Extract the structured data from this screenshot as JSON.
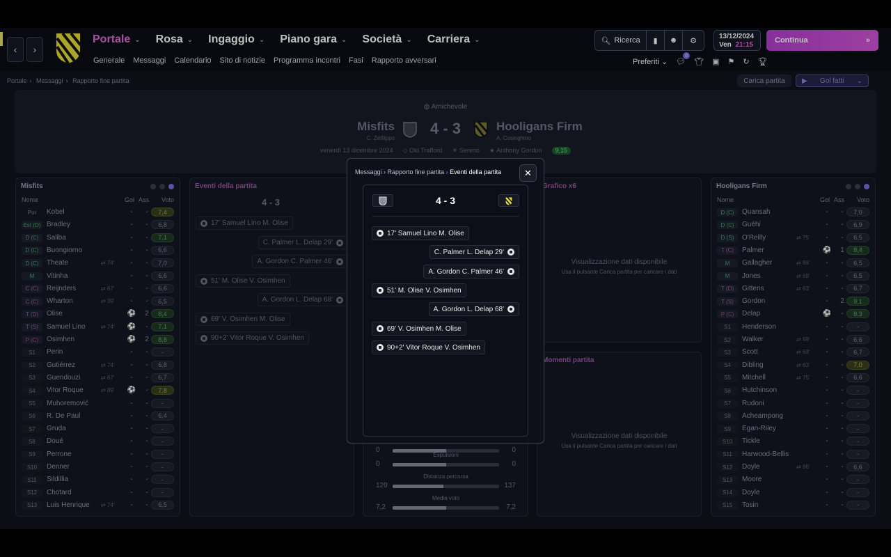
{
  "nav": {
    "items": [
      {
        "label": "Portale",
        "active": true
      },
      {
        "label": "Rosa"
      },
      {
        "label": "Ingaggio"
      },
      {
        "label": "Piano gara"
      },
      {
        "label": "Società"
      },
      {
        "label": "Carriera"
      }
    ],
    "sub": [
      "Generale",
      "Messaggi",
      "Calendario",
      "Sito di notizie",
      "Programma incontri",
      "Fasi",
      "Rapporto avversari"
    ],
    "search_label": "Ricerca",
    "date": "13/12/2024",
    "day": "Ven",
    "time": "21:15",
    "continue_label": "Continua",
    "favorites_label": "Preferiti",
    "notif_count": "0"
  },
  "breadcrumb": [
    "Portale",
    "Messaggi",
    "Rapporto fine partita"
  ],
  "actions": {
    "load_label": "Carica partita",
    "goals_label": "Gol fatti"
  },
  "match": {
    "competition": "Amichevole",
    "home": "Misfits",
    "home_coach": "C. Zefilippo",
    "away": "Hooligans Firm",
    "away_coach": "A. Cosinghino",
    "score": "4 - 3",
    "date": "venerdì 13 dicembre 2024",
    "stadium": "Old Trafford",
    "weather": "Sereno",
    "potm": "Anthony Gordon",
    "potm_rating": "9,15"
  },
  "columns": {
    "name": "Nome",
    "goals": "Gol",
    "assists": "Ass",
    "rating": "Voto"
  },
  "home_players": [
    {
      "pos": "Por",
      "cls": "por",
      "name": "Kobel",
      "ev": "",
      "g": "-",
      "a": "-",
      "v": "7,4",
      "vc": "yellow"
    },
    {
      "pos": "Est (D)",
      "cls": "dc",
      "name": "Bradley",
      "ev": "",
      "g": "-",
      "a": "-",
      "v": "6,8",
      "vc": ""
    },
    {
      "pos": "D (C)",
      "cls": "dc",
      "name": "Saliba",
      "ev": "",
      "g": "-",
      "a": "-",
      "v": "7,1",
      "vc": "green"
    },
    {
      "pos": "D (C)",
      "cls": "dc",
      "name": "Buongiorno",
      "ev": "",
      "g": "-",
      "a": "-",
      "v": "6,6",
      "vc": ""
    },
    {
      "pos": "D (C)",
      "cls": "dc",
      "name": "Theate",
      "ev": "74'",
      "g": "-",
      "a": "-",
      "v": "7,0",
      "vc": ""
    },
    {
      "pos": "M",
      "cls": "mc",
      "name": "Vitinha",
      "ev": "",
      "g": "-",
      "a": "-",
      "v": "6,6",
      "vc": ""
    },
    {
      "pos": "C (C)",
      "cls": "tc",
      "name": "Reijnders",
      "ev": "67'",
      "g": "-",
      "a": "-",
      "v": "6,6",
      "vc": ""
    },
    {
      "pos": "C (C)",
      "cls": "tc",
      "name": "Wharton",
      "ev": "39'",
      "g": "-",
      "a": "-",
      "v": "6,5",
      "vc": ""
    },
    {
      "pos": "T (D)",
      "cls": "tc",
      "name": "Olise",
      "ev": "",
      "g": "⚽",
      "a": "2",
      "v": "8,4",
      "vc": "green"
    },
    {
      "pos": "T (S)",
      "cls": "tc",
      "name": "Samuel Lino",
      "ev": "74'",
      "g": "⚽",
      "a": "-",
      "v": "7,1",
      "vc": "green"
    },
    {
      "pos": "P (C)",
      "cls": "pc",
      "name": "Osimhen",
      "ev": "",
      "g": "⚽",
      "a": "2",
      "v": "8,8",
      "vc": "green"
    },
    {
      "pos": "S1",
      "cls": "sub",
      "name": "Perin",
      "ev": "",
      "g": "-",
      "a": "-",
      "v": "-",
      "vc": ""
    },
    {
      "pos": "S2",
      "cls": "sub",
      "name": "Gutiérrez",
      "ev": "74'",
      "g": "-",
      "a": "-",
      "v": "6,8",
      "vc": ""
    },
    {
      "pos": "S3",
      "cls": "sub",
      "name": "Guendouzi",
      "ev": "67'",
      "g": "-",
      "a": "-",
      "v": "6,7",
      "vc": ""
    },
    {
      "pos": "S4",
      "cls": "sub",
      "name": "Vitor Roque",
      "ev": "89'",
      "g": "⚽",
      "a": "-",
      "v": "7,8",
      "vc": "yellow"
    },
    {
      "pos": "S5",
      "cls": "sub",
      "name": "Muhoremović",
      "ev": "",
      "g": "-",
      "a": "-",
      "v": "-",
      "vc": ""
    },
    {
      "pos": "S6",
      "cls": "sub",
      "name": "R. De Paul",
      "ev": "",
      "g": "-",
      "a": "-",
      "v": "6,4",
      "vc": ""
    },
    {
      "pos": "S7",
      "cls": "sub",
      "name": "Gruda",
      "ev": "",
      "g": "-",
      "a": "-",
      "v": "-",
      "vc": ""
    },
    {
      "pos": "S8",
      "cls": "sub",
      "name": "Doué",
      "ev": "",
      "g": "-",
      "a": "-",
      "v": "-",
      "vc": ""
    },
    {
      "pos": "S9",
      "cls": "sub",
      "name": "Perrone",
      "ev": "",
      "g": "-",
      "a": "-",
      "v": "-",
      "vc": ""
    },
    {
      "pos": "S10",
      "cls": "sub",
      "name": "Denner",
      "ev": "",
      "g": "-",
      "a": "-",
      "v": "-",
      "vc": ""
    },
    {
      "pos": "S11",
      "cls": "sub",
      "name": "Sildillia",
      "ev": "",
      "g": "-",
      "a": "-",
      "v": "-",
      "vc": ""
    },
    {
      "pos": "S12",
      "cls": "sub",
      "name": "Chotard",
      "ev": "",
      "g": "-",
      "a": "-",
      "v": "-",
      "vc": ""
    },
    {
      "pos": "S13",
      "cls": "sub",
      "name": "Luis Henrique",
      "ev": "74'",
      "g": "-",
      "a": "-",
      "v": "6,5",
      "vc": ""
    }
  ],
  "away_players": [
    {
      "pos": "D (C)",
      "cls": "dc",
      "name": "Quansah",
      "ev": "",
      "g": "-",
      "a": "-",
      "v": "7,0",
      "vc": ""
    },
    {
      "pos": "D (C)",
      "cls": "dc",
      "name": "Guéhi",
      "ev": "",
      "g": "-",
      "a": "-",
      "v": "6,9",
      "vc": ""
    },
    {
      "pos": "D (S)",
      "cls": "dc",
      "name": "O'Reilly",
      "ev": "75'",
      "g": "-",
      "a": "-",
      "v": "6,5",
      "vc": ""
    },
    {
      "pos": "T (C)",
      "cls": "tc",
      "name": "Palmer",
      "ev": "",
      "g": "⚽",
      "a": "1",
      "v": "8,4",
      "vc": "green"
    },
    {
      "pos": "M",
      "cls": "mc",
      "name": "Gallagher",
      "ev": "86'",
      "g": "-",
      "a": "-",
      "v": "6,5",
      "vc": ""
    },
    {
      "pos": "M",
      "cls": "mc",
      "name": "Jones",
      "ev": "69'",
      "g": "-",
      "a": "-",
      "v": "6,5",
      "vc": ""
    },
    {
      "pos": "T (D)",
      "cls": "tc",
      "name": "Gittens",
      "ev": "63'",
      "g": "-",
      "a": "-",
      "v": "6,7",
      "vc": ""
    },
    {
      "pos": "T (S)",
      "cls": "tc",
      "name": "Gordon",
      "ev": "",
      "g": "-",
      "a": "2",
      "v": "9,1",
      "vc": "green"
    },
    {
      "pos": "P (C)",
      "cls": "pc",
      "name": "Delap",
      "ev": "",
      "g": "⚽",
      "a": "-",
      "v": "8,3",
      "vc": "green"
    },
    {
      "pos": "S1",
      "cls": "sub",
      "name": "Henderson",
      "ev": "",
      "g": "-",
      "a": "-",
      "v": "-",
      "vc": ""
    },
    {
      "pos": "S2",
      "cls": "sub",
      "name": "Walker",
      "ev": "59'",
      "g": "-",
      "a": "-",
      "v": "6,6",
      "vc": ""
    },
    {
      "pos": "S3",
      "cls": "sub",
      "name": "Scott",
      "ev": "69'",
      "g": "-",
      "a": "-",
      "v": "6,7",
      "vc": ""
    },
    {
      "pos": "S4",
      "cls": "sub",
      "name": "Dibling",
      "ev": "63'",
      "g": "-",
      "a": "-",
      "v": "7,0",
      "vc": "yellow"
    },
    {
      "pos": "S5",
      "cls": "sub",
      "name": "Mitchell",
      "ev": "75'",
      "g": "-",
      "a": "-",
      "v": "6,6",
      "vc": ""
    },
    {
      "pos": "S6",
      "cls": "sub",
      "name": "Hutchinson",
      "ev": "",
      "g": "-",
      "a": "-",
      "v": "-",
      "vc": ""
    },
    {
      "pos": "S7",
      "cls": "sub",
      "name": "Rudoni",
      "ev": "",
      "g": "-",
      "a": "-",
      "v": "-",
      "vc": ""
    },
    {
      "pos": "S8",
      "cls": "sub",
      "name": "Acheampong",
      "ev": "",
      "g": "-",
      "a": "-",
      "v": "-",
      "vc": ""
    },
    {
      "pos": "S9",
      "cls": "sub",
      "name": "Egan-Riley",
      "ev": "",
      "g": "-",
      "a": "-",
      "v": "-",
      "vc": ""
    },
    {
      "pos": "S10",
      "cls": "sub",
      "name": "Tickle",
      "ev": "",
      "g": "-",
      "a": "-",
      "v": "-",
      "vc": ""
    },
    {
      "pos": "S11",
      "cls": "sub",
      "name": "Harwood-Bellis",
      "ev": "",
      "g": "-",
      "a": "-",
      "v": "-",
      "vc": ""
    },
    {
      "pos": "S12",
      "cls": "sub",
      "name": "Doyle",
      "ev": "86'",
      "g": "-",
      "a": "-",
      "v": "6,6",
      "vc": ""
    },
    {
      "pos": "S13",
      "cls": "sub",
      "name": "Moore",
      "ev": "",
      "g": "-",
      "a": "-",
      "v": "-",
      "vc": ""
    },
    {
      "pos": "S14",
      "cls": "sub",
      "name": "Doyle",
      "ev": "",
      "g": "-",
      "a": "-",
      "v": "-",
      "vc": ""
    },
    {
      "pos": "S15",
      "cls": "sub",
      "name": "Tosin",
      "ev": "",
      "g": "-",
      "a": "-",
      "v": "-",
      "vc": ""
    }
  ],
  "panels": {
    "events_title": "Eventi della partita",
    "xg_title": "Grafico x6",
    "moments_title": "Momenti partita",
    "empty_main": "Visualizzazione dati disponibile",
    "empty_sub": "Usa il pulsante Carica partita per caricare i dati"
  },
  "events": [
    {
      "text": "17'  Samuel Lino  M. Olise",
      "side": "home"
    },
    {
      "text": "C. Palmer  L. Delap  29'",
      "side": "away"
    },
    {
      "text": "A. Gordon  C. Palmer  46'",
      "side": "away"
    },
    {
      "text": "51'  M. Olise  V. Osimhen",
      "side": "home"
    },
    {
      "text": "A. Gordon  L. Delap  68'",
      "side": "away"
    },
    {
      "text": "69'  V. Osimhen  M. Olise",
      "side": "home"
    },
    {
      "text": "90+2'  Vitor Roque  V. Osimhen",
      "side": "home"
    }
  ],
  "stats": [
    {
      "label": "",
      "l": "0",
      "r": "0",
      "fill": 0.5
    },
    {
      "label": "Espulsioni",
      "l": "0",
      "r": "0",
      "fill": 0.5
    },
    {
      "label": "Distanza percorsa",
      "l": "129",
      "r": "137",
      "fill": 0.48
    },
    {
      "label": "Media voto",
      "l": "7,2",
      "r": "7,2",
      "fill": 0.5
    }
  ],
  "modal": {
    "crumb": [
      "Messaggi",
      "Rapporto fine partita",
      "Eventi della partita"
    ],
    "score": "4 - 3"
  }
}
